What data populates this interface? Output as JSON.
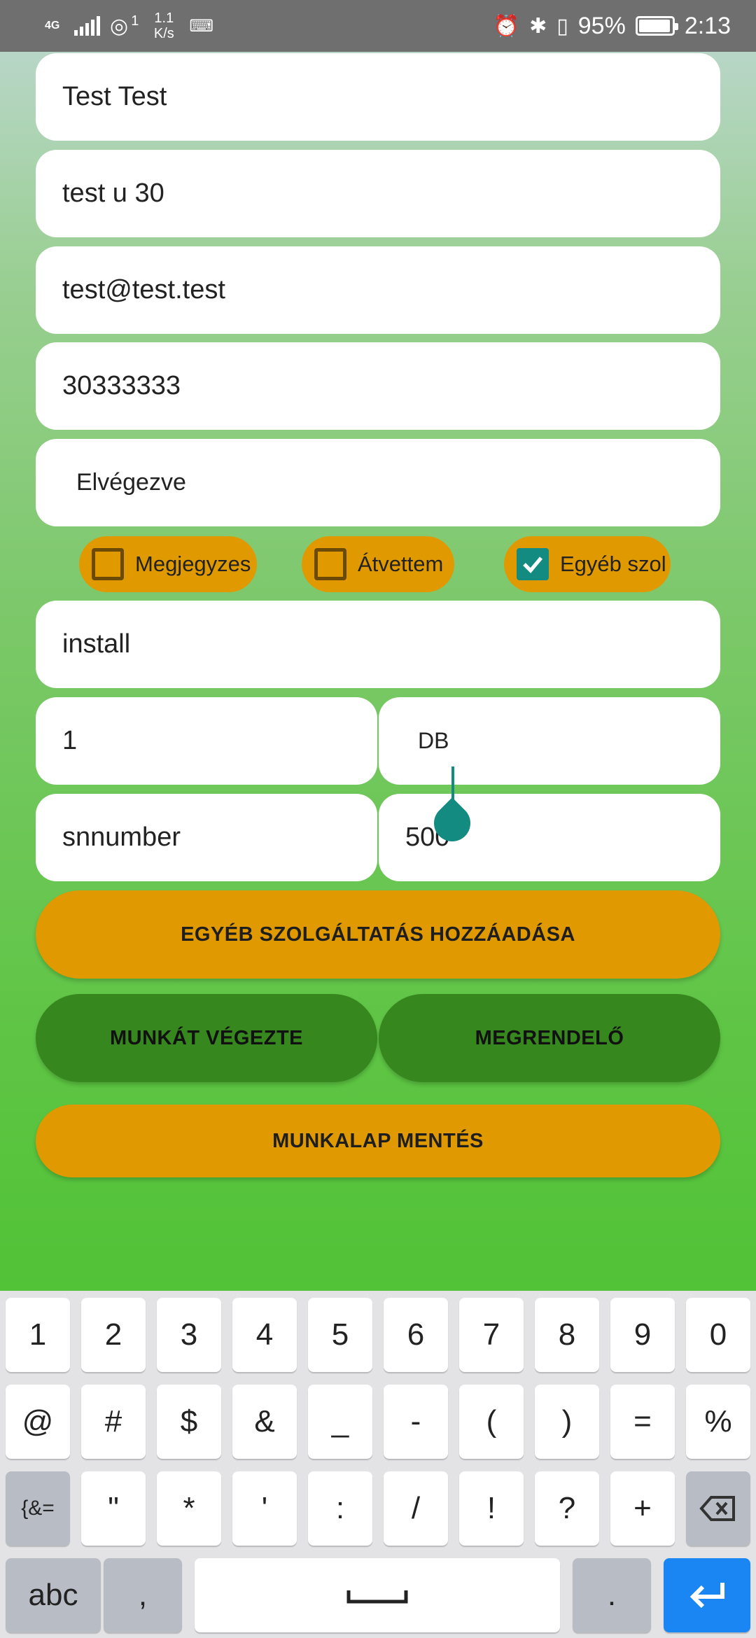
{
  "status_bar": {
    "network": "4G",
    "hotspot_count": "1",
    "speed_value": "1.1",
    "speed_unit": "K/s",
    "battery": "95%",
    "time": "2:13"
  },
  "form": {
    "name": "Test Test",
    "address": "test u 30",
    "email": "test@test.test",
    "phone": "30333333",
    "status": "Elvégezve",
    "checkboxes": [
      {
        "label": "Megjegyzes",
        "checked": false
      },
      {
        "label": "Átvettem",
        "checked": false
      },
      {
        "label": "Egyéb szol",
        "checked": true
      }
    ],
    "service": "install",
    "quantity": "1",
    "unit": "DB",
    "serial": "snnumber",
    "price": "500"
  },
  "buttons": {
    "add_service": "EGYÉB SZOLGÁLTATÁS HOZZÁADÁSA",
    "worker": "MUNKÁT VÉGEZTE",
    "customer": "MEGRENDELŐ",
    "save": "MUNKALAP MENTÉS"
  },
  "keyboard": {
    "row1": [
      "1",
      "2",
      "3",
      "4",
      "5",
      "6",
      "7",
      "8",
      "9",
      "0"
    ],
    "row2": [
      "@",
      "#",
      "$",
      "&",
      "_",
      "-",
      "(",
      ")",
      "=",
      "%"
    ],
    "row3": [
      "{&=",
      "\"",
      "*",
      "'",
      ":",
      "/",
      "!",
      "?",
      "+"
    ],
    "abc": "abc",
    "comma": ",",
    "period": "."
  },
  "colors": {
    "accent_orange": "#e09a00",
    "accent_green": "#37871f",
    "teal": "#138b80",
    "enter_blue": "#1a86f3"
  }
}
